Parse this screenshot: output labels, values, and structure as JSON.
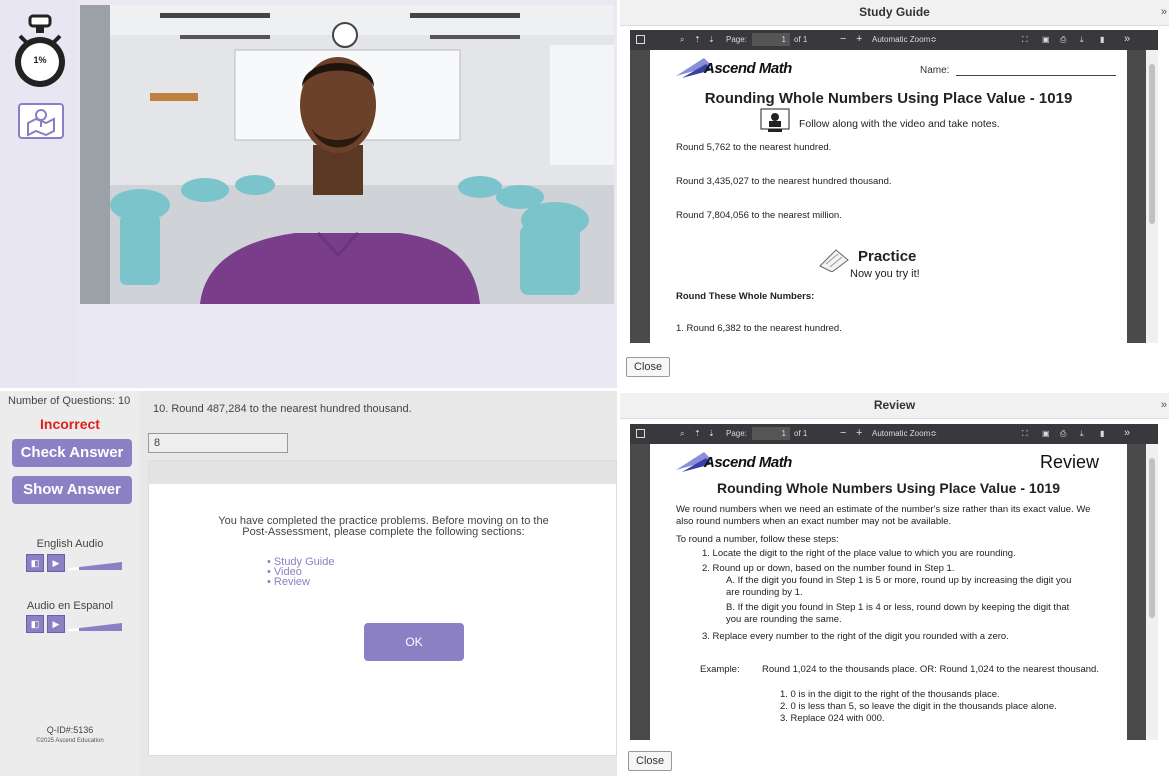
{
  "timer": {
    "percent": "1%"
  },
  "study_guide": {
    "panel_title": "Study Guide",
    "close_x": "»",
    "toolbar": {
      "page_label": "Page:",
      "page_value": "1",
      "page_of": "of 1",
      "zoom": "Automatic Zoom≎",
      "more": "»"
    },
    "brand": "Ascend Math",
    "name_label": "Name:",
    "title": "Rounding Whole Numbers Using Place Value - 1019",
    "follow": "Follow along with the video and take notes.",
    "items": [
      "Round 5,762 to the nearest hundred.",
      "Round 3,435,027 to the nearest hundred thousand.",
      "Round 7,804,056 to the nearest million."
    ],
    "practice_title": "Practice",
    "practice_sub": "Now you try it!",
    "round_these": "Round These Whole Numbers:",
    "q1": "1. Round 6,382 to the nearest hundred.",
    "close": "Close"
  },
  "quiz": {
    "num_questions": "Number of Questions: 10",
    "status": "Incorrect",
    "check_answer": "Check Answer",
    "show_answer": "Show Answer",
    "english_audio": "English Audio",
    "spanish_audio": "Audio en Espanol",
    "qid": "Q-ID#:5136",
    "copyright": "©2025 Ascend Education",
    "question": "10. Round 487,284 to the nearest hundred thousand.",
    "answer_value": "8",
    "dialog_text_1": "You have completed the practice problems. Before moving on to the",
    "dialog_text_2": "Post-Assessment, please complete the following sections:",
    "sections": [
      "Study Guide",
      "Video",
      "Review"
    ],
    "ok": "OK"
  },
  "review": {
    "panel_title": "Review",
    "close_x": "»",
    "toolbar": {
      "page_label": "Page:",
      "page_value": "1",
      "page_of": "of 1",
      "zoom": "Automatic Zoom≎",
      "more": "»"
    },
    "brand": "Ascend Math",
    "heading": "Review",
    "title": "Rounding Whole Numbers Using Place Value - 1019",
    "p1": "We round numbers when we need an estimate of the number's size rather than its exact value. We also round numbers when an exact number may not be available.",
    "p2": "To round a number, follow these steps:",
    "steps": [
      "1. Locate the digit to the right of the place value to which you are rounding.",
      "2. Round up or down, based on the number found in Step 1.",
      "A. If the digit you found in Step 1 is 5 or more, round up by increasing the digit you are rounding by 1.",
      "B. If the digit you found in Step 1 is 4 or less, round down by keeping the digit that you are rounding the same.",
      "3. Replace every number to the right of the digit you rounded with a zero."
    ],
    "example_label": "Example:",
    "example_text": "Round 1,024 to the thousands place. OR: Round 1,024 to the nearest thousand.",
    "example_steps": [
      "1. 0 is in the digit to the right of the thousands place.",
      "2. 0 is less than 5, so leave the digit in the thousands place alone.",
      "3. Replace 024 with 000."
    ],
    "close": "Close"
  }
}
